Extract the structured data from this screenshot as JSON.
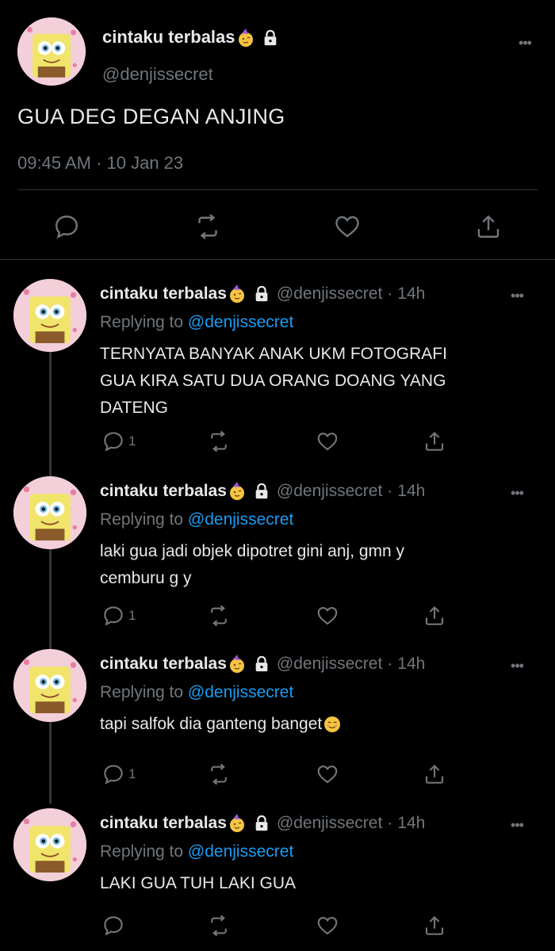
{
  "main_tweet": {
    "display_name": "cintaku terbalas",
    "name_emoji": "face-with-party-hat-emoji",
    "lock_icon": "lock-icon",
    "handle": "@denjissecret",
    "text": "GUA DEG DEGAN ANJING",
    "timestamp": "09:45 AM · 10 Jan 23",
    "actions": [
      "reply-icon",
      "retweet-icon",
      "like-icon",
      "share-icon"
    ]
  },
  "replies": [
    {
      "display_name": "cintaku terbalas",
      "handle": "@denjissecret",
      "separator": "·",
      "time": "14h",
      "replying_prefix": "Replying to",
      "replying_handle": "@denjissecret",
      "lines": [
        "TERNYATA BANYAK ANAK UKM FOTOGRAFI",
        "GUA KIRA SATU DUA ORANG DOANG YANG",
        "DATENG"
      ],
      "reply_count": "1"
    },
    {
      "display_name": "cintaku terbalas",
      "handle": "@denjissecret",
      "separator": "·",
      "time": "14h",
      "replying_prefix": "Replying to",
      "replying_handle": "@denjissecret",
      "lines": [
        "laki gua jadi objek dipotret gini anj, gmn y",
        "cemburu g y"
      ],
      "reply_count": "1"
    },
    {
      "display_name": "cintaku terbalas",
      "handle": "@denjissecret",
      "separator": "·",
      "time": "14h",
      "replying_prefix": "Replying to",
      "replying_handle": "@denjissecret",
      "lines": [
        "tapi salfok dia ganteng banget"
      ],
      "line_emoji": "relieved-smile-emoji",
      "reply_count": "1"
    },
    {
      "display_name": "cintaku terbalas",
      "handle": "@denjissecret",
      "separator": "·",
      "time": "14h",
      "replying_prefix": "Replying to",
      "replying_handle": "@denjissecret",
      "lines": [
        "LAKI GUA TUH LAKI GUA"
      ],
      "reply_count": ""
    }
  ],
  "colors": {
    "background": "#000000",
    "text": "#e7e9ea",
    "muted": "#71767b",
    "link": "#1d9bf0",
    "divider": "#2f3336"
  }
}
